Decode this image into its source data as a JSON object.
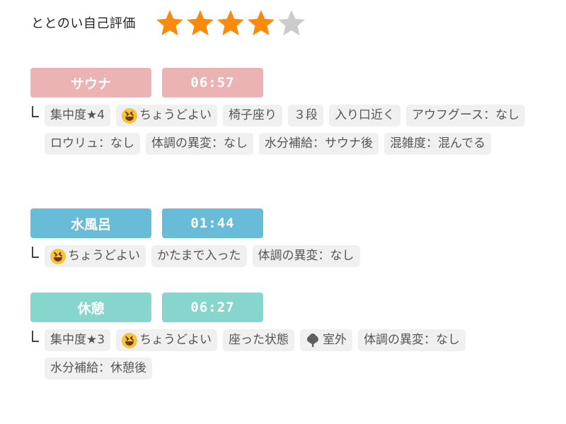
{
  "rating": {
    "label": "ととのい自己評価",
    "value": 4,
    "max": 5,
    "star_color_on": "#f98a0e",
    "star_color_off": "#cccccc"
  },
  "sections": [
    {
      "name": "サウナ",
      "time": "06:57",
      "color_name": "#ebb3b4",
      "color_time": "#ebb3b4",
      "tags": [
        {
          "text": "集中度★4"
        },
        {
          "icon": "grinning-squinting-face-icon",
          "text": "ちょうどよい"
        },
        {
          "text": "椅子座り"
        },
        {
          "text": "３段"
        },
        {
          "text": "入り口近く"
        },
        {
          "text": "アウフグース：なし"
        },
        {
          "text": "ロウリュ：なし"
        },
        {
          "text": "体調の異変：なし"
        },
        {
          "text": "水分補給：サウナ後"
        },
        {
          "text": "混雑度：混んでる"
        }
      ]
    },
    {
      "name": "水風呂",
      "time": "01:44",
      "color_name": "#68bcd8",
      "color_time": "#68bcd8",
      "tags": [
        {
          "icon": "grinning-squinting-face-icon",
          "text": "ちょうどよい"
        },
        {
          "text": "かたまで入った"
        },
        {
          "text": "体調の異変：なし"
        }
      ]
    },
    {
      "name": "休憩",
      "time": "06:27",
      "color_name": "#86d6ce",
      "color_time": "#86d6ce",
      "tags": [
        {
          "text": "集中度★3"
        },
        {
          "icon": "grinning-squinting-face-icon",
          "text": "ちょうどよい"
        },
        {
          "text": "座った状態"
        },
        {
          "icon": "tree-icon",
          "text": "室外"
        },
        {
          "text": "体調の異変：なし"
        },
        {
          "text": "水分補給：休憩後"
        }
      ]
    }
  ]
}
